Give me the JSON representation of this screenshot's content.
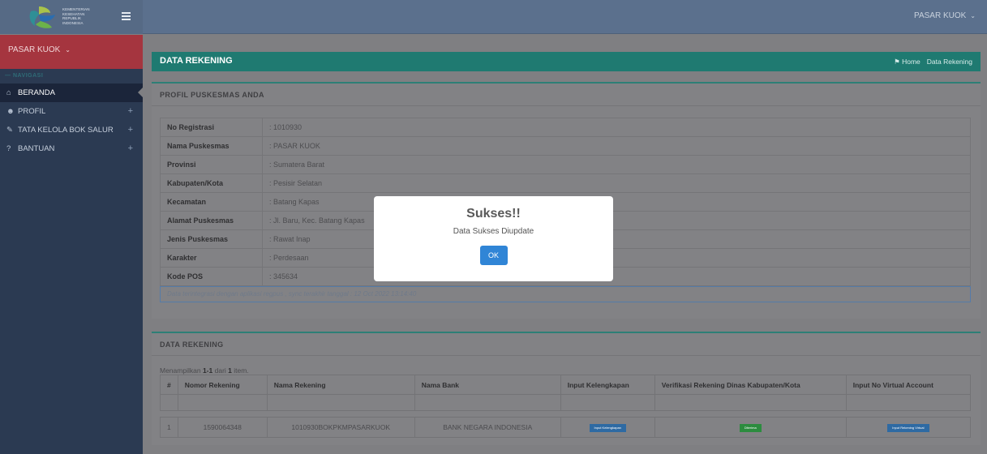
{
  "header": {
    "logo_text": [
      "KEMENTERIAN",
      "KESEHATAN",
      "REPUBLIK",
      "INDONESIA"
    ],
    "user": "PASAR KUOK"
  },
  "sidebar": {
    "user": "PASAR KUOK",
    "category": "NAVIGASI",
    "items": [
      {
        "label": "BERANDA",
        "icon": "home-icon",
        "active": true
      },
      {
        "label": "PROFIL",
        "icon": "user-icon",
        "expandable": true
      },
      {
        "label": "TATA KELOLA BOK SALUR",
        "icon": "edit-icon",
        "expandable": true
      },
      {
        "label": "BANTUAN",
        "icon": "question-icon",
        "expandable": true
      }
    ]
  },
  "page": {
    "title": "DATA REKENING",
    "breadcrumb": [
      "Home",
      "Data Rekening"
    ]
  },
  "profile": {
    "title": "PROFIL PUSKESMAS ANDA",
    "rows": [
      {
        "label": "No Registrasi",
        "value": ": 1010930"
      },
      {
        "label": "Nama Puskesmas",
        "value": ": PASAR KUOK"
      },
      {
        "label": "Provinsi",
        "value": ": Sumatera Barat"
      },
      {
        "label": "Kabupaten/Kota",
        "value": ": Pesisir Selatan"
      },
      {
        "label": "Kecamatan",
        "value": ": Batang Kapas"
      },
      {
        "label": "Alamat Puskesmas",
        "value": ": Jl. Baru, Kec. Batang Kapas"
      },
      {
        "label": "Jenis Puskesmas",
        "value": ": Rawat Inap"
      },
      {
        "label": "Karakter",
        "value": ": Perdesaan"
      },
      {
        "label": "Kode POS",
        "value": ": 345634"
      }
    ],
    "sync_note": "Data terintegrasi dengan aplikasi regpus , sync terakhir tanggal : 12 Oct 2022 13:14:40"
  },
  "rekening": {
    "title": "DATA REKENING",
    "summary_prefix": "Menampilkan",
    "summary_range": "1-1",
    "summary_mid": "dari",
    "summary_total": "1",
    "summary_suffix": "item.",
    "columns": [
      "#",
      "Nomor Rekening",
      "Nama Rekening",
      "Nama Bank",
      "Input Kelengkapan",
      "Verifikasi Rekening Dinas Kabupaten/Kota",
      "Input No Virtual Account"
    ],
    "rows": [
      {
        "no": "1",
        "nomor": "1590064348",
        "nama": "1010930BOKPKMPASARKUOK",
        "bank": "BANK NEGARA INDONESIA",
        "btn_kelengkapan": "Input Kelengkapan",
        "btn_verifikasi": "Diterima",
        "btn_virtual": "Input Rekening Virtual"
      }
    ]
  },
  "modal": {
    "title": "Sukses!!",
    "text": "Data Sukses Diupdate",
    "ok": "OK"
  },
  "colors": {
    "accent": "#1f7a71",
    "sidebar": "#2b3a52",
    "sidebar_user": "#a5353f",
    "ok_button": "#3085d6"
  }
}
